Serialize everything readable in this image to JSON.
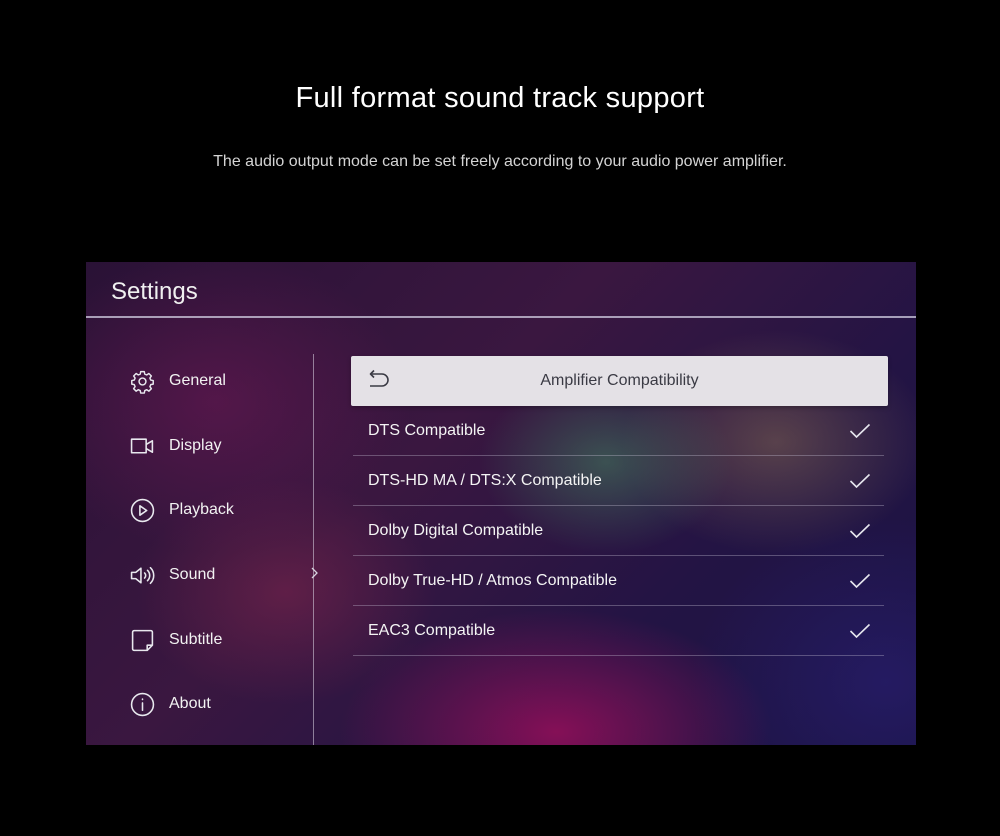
{
  "banner": {
    "headline": "Full format sound track support",
    "subline": "The audio output mode can be set freely according to your audio power amplifier."
  },
  "settings": {
    "title": "Settings",
    "nav": [
      {
        "label": "General",
        "icon": "gear-icon"
      },
      {
        "label": "Display",
        "icon": "camera-icon"
      },
      {
        "label": "Playback",
        "icon": "play-circle-icon"
      },
      {
        "label": "Sound",
        "icon": "speaker-icon"
      },
      {
        "label": "Subtitle",
        "icon": "subtitle-icon"
      },
      {
        "label": "About",
        "icon": "info-icon"
      }
    ],
    "selected_nav": "Sound",
    "panel": {
      "title": "Amplifier Compatibility",
      "back_icon": "back-arrow-icon",
      "options": [
        {
          "label": "DTS Compatible",
          "checked": true
        },
        {
          "label": "DTS-HD MA / DTS:X Compatible",
          "checked": true
        },
        {
          "label": "Dolby Digital Compatible",
          "checked": true
        },
        {
          "label": "Dolby True-HD / Atmos Compatible",
          "checked": true
        },
        {
          "label": "EAC3 Compatible",
          "checked": true
        }
      ]
    }
  },
  "colors": {
    "page_background": "#000000",
    "panel_header_background": "#e4e1e6",
    "text_primary": "#f4f4f4"
  }
}
